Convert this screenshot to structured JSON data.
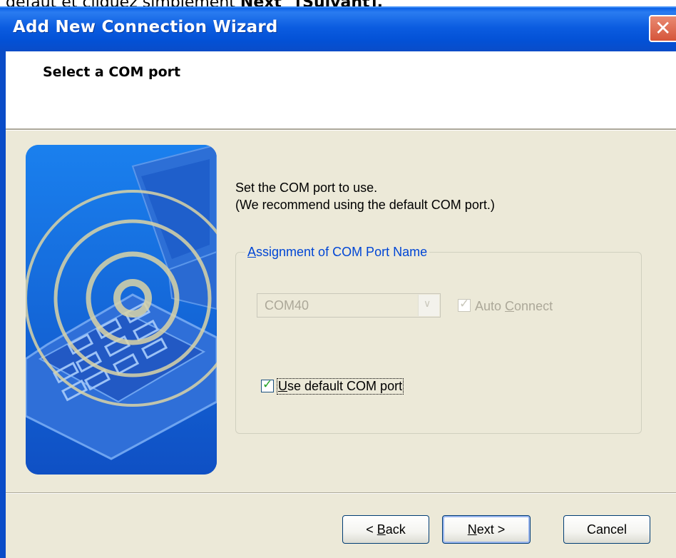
{
  "document": {
    "line_prefix": "défaut et cliquez simplement ",
    "line_bold": "Next\" [Suivant]."
  },
  "window": {
    "title": "Add New Connection Wizard",
    "close_glyph": "✕"
  },
  "header": {
    "title": "Select a COM port"
  },
  "body": {
    "instruction_line1": "Set the COM port to use.",
    "instruction_line2": "(We recommend using the default COM port.)",
    "group_label_mnemonic": "A",
    "group_label_rest": "ssignment of COM Port Name",
    "com_port": {
      "value": "COM40",
      "enabled": false
    },
    "auto_connect": {
      "label_prefix": "Auto ",
      "label_mnemonic": "C",
      "label_rest": "onnect",
      "checked": true,
      "enabled": false
    },
    "use_default": {
      "label_mnemonic": "U",
      "label_rest": "se default COM port",
      "checked": true
    }
  },
  "buttons": {
    "back": {
      "prefix": "< ",
      "mnemonic": "B",
      "rest": "ack"
    },
    "next": {
      "mnemonic": "N",
      "rest": "ext >"
    },
    "cancel": {
      "label": "Cancel"
    }
  },
  "colors": {
    "titlebar": "#0351d6",
    "dialog_bg": "#ece9d8",
    "group_label": "#0046d5",
    "checkmark": "#21a121",
    "disabled_text": "#aca899"
  },
  "icons": {
    "checkbox_check": "check-icon",
    "combo_arrow": "chevron-down-icon",
    "illustration": "phone-laptop-wireless-illustration"
  }
}
